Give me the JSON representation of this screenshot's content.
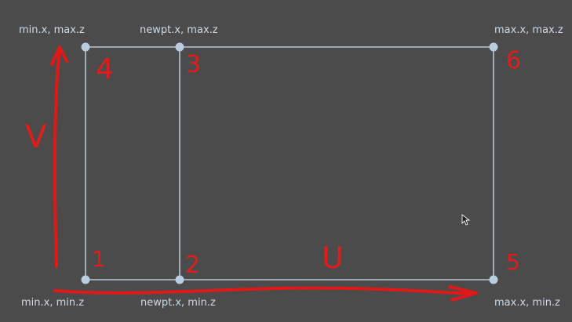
{
  "diagram": {
    "corner_labels": {
      "top_left": "min.x, max.z",
      "top_mid": "newpt.x, max.z",
      "top_right": "max.x, max.z",
      "bottom_left": "min.x, min.z",
      "bottom_mid": "newpt.x, min.z",
      "bottom_right": "max.x, min.z"
    },
    "vertex_numbers": {
      "n1": "1",
      "n2": "2",
      "n3": "3",
      "n4": "4",
      "n5": "5",
      "n6": "6"
    },
    "axis_letters": {
      "u": "U",
      "v": "V"
    },
    "colors": {
      "background": "#4b4b4b",
      "edges": "#b7c6d3",
      "vertices": "#b9cde0",
      "annotation": "#e01818",
      "label_text": "#cdd9e3"
    }
  }
}
